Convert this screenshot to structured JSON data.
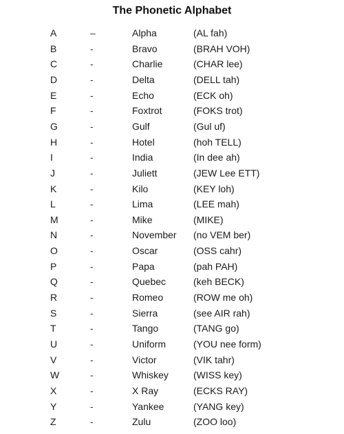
{
  "title": "The Phonetic Alphabet",
  "rows": [
    {
      "letter": "A",
      "sep": "–",
      "word": "Alpha",
      "pronunciation": "(AL fah)"
    },
    {
      "letter": "B",
      "sep": "-",
      "word": "Bravo",
      "pronunciation": "(BRAH VOH)"
    },
    {
      "letter": "C",
      "sep": "-",
      "word": "Charlie",
      "pronunciation": "(CHAR lee)"
    },
    {
      "letter": "D",
      "sep": "-",
      "word": "Delta",
      "pronunciation": "(DELL tah)"
    },
    {
      "letter": "E",
      "sep": "-",
      "word": "Echo",
      "pronunciation": "(ECK oh)"
    },
    {
      "letter": "F",
      "sep": "-",
      "word": "Foxtrot",
      "pronunciation": "(FOKS trot)"
    },
    {
      "letter": "G",
      "sep": "-",
      "word": "Gulf",
      "pronunciation": "(Gul uf)"
    },
    {
      "letter": "H",
      "sep": "-",
      "word": "Hotel",
      "pronunciation": "(hoh TELL)"
    },
    {
      "letter": "I",
      "sep": "-",
      "word": "India",
      "pronunciation": "(In dee ah)"
    },
    {
      "letter": "J",
      "sep": "-",
      "word": "Juliett",
      "pronunciation": "(JEW Lee ETT)"
    },
    {
      "letter": "K",
      "sep": "-",
      "word": "Kilo",
      "pronunciation": "(KEY loh)"
    },
    {
      "letter": "L",
      "sep": "-",
      "word": "Lima",
      "pronunciation": "(LEE mah)"
    },
    {
      "letter": "M",
      "sep": "-",
      "word": "Mike",
      "pronunciation": "(MIKE)"
    },
    {
      "letter": "N",
      "sep": "-",
      "word": "November",
      "pronunciation": "(no VEM ber)"
    },
    {
      "letter": "O",
      "sep": "-",
      "word": "Oscar",
      "pronunciation": "(OSS cahr)"
    },
    {
      "letter": "P",
      "sep": "-",
      "word": "Papa",
      "pronunciation": "(pah PAH)"
    },
    {
      "letter": "Q",
      "sep": "-",
      "word": "Quebec",
      "pronunciation": "(keh BECK)"
    },
    {
      "letter": "R",
      "sep": "-",
      "word": "Romeo",
      "pronunciation": "(ROW me oh)"
    },
    {
      "letter": "S",
      "sep": "-",
      "word": "Sierra",
      "pronunciation": "(see AIR rah)"
    },
    {
      "letter": "T",
      "sep": "-",
      "word": "Tango",
      "pronunciation": "(TANG go)"
    },
    {
      "letter": "U",
      "sep": "-",
      "word": "Uniform",
      "pronunciation": "(YOU nee form)"
    },
    {
      "letter": "V",
      "sep": "-",
      "word": "Victor",
      "pronunciation": "(VIK tahr)"
    },
    {
      "letter": "W",
      "sep": "-",
      "word": "Whiskey",
      "pronunciation": "(WISS key)"
    },
    {
      "letter": "X",
      "sep": "-",
      "word": "X Ray",
      "pronunciation": "(ECKS RAY)"
    },
    {
      "letter": "Y",
      "sep": "-",
      "word": "Yankee",
      "pronunciation": "(YANG key)"
    },
    {
      "letter": "Z",
      "sep": "-",
      "word": "Zulu",
      "pronunciation": "(ZOO loo)"
    }
  ]
}
